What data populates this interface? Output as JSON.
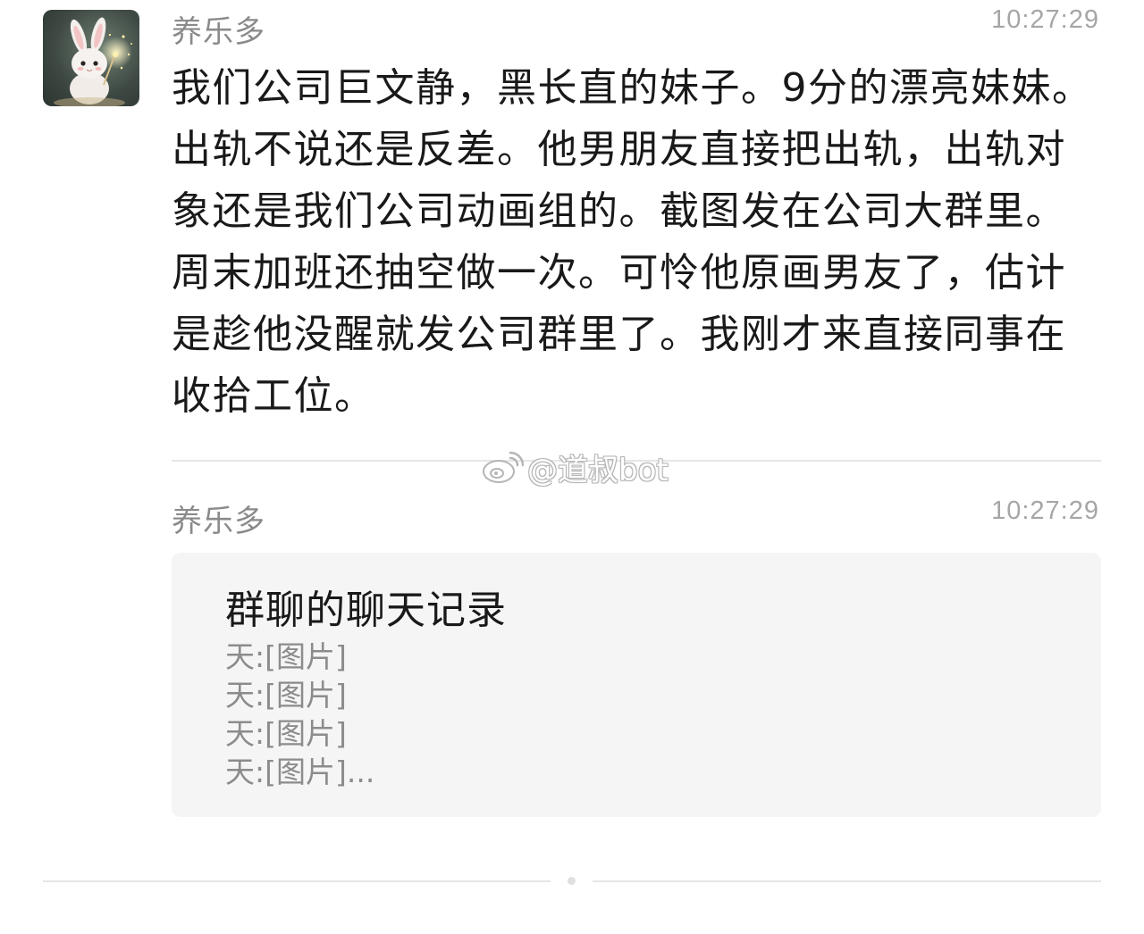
{
  "messages": [
    {
      "sender": "养乐多",
      "time": "10:27:29",
      "text": "我们公司巨文静，黑长直的妹子。9分的漂亮妹妹。出轨不说还是反差。他男朋友直接把出轨，出轨对象还是我们公司动画组的。截图发在公司大群里。周末加班还抽空做一次。可怜他原画男友了，估计是趁他没醒就发公司群里了。我刚才来直接同事在收拾工位。",
      "avatar_icon": "bunny-avatar"
    },
    {
      "sender": "养乐多",
      "time": "10:27:29",
      "record": {
        "title": "群聊的聊天记录",
        "lines": [
          "天:[图片]",
          "天:[图片]",
          "天:[图片]",
          "天:[图片]..."
        ]
      }
    }
  ],
  "watermark": {
    "text": "@道叔bot",
    "icon": "weibo-icon"
  },
  "colors": {
    "background": "#ffffff",
    "card": "#f5f5f5",
    "sender": "#8a8a8a",
    "time": "#a6a6a6",
    "text": "#191919"
  }
}
